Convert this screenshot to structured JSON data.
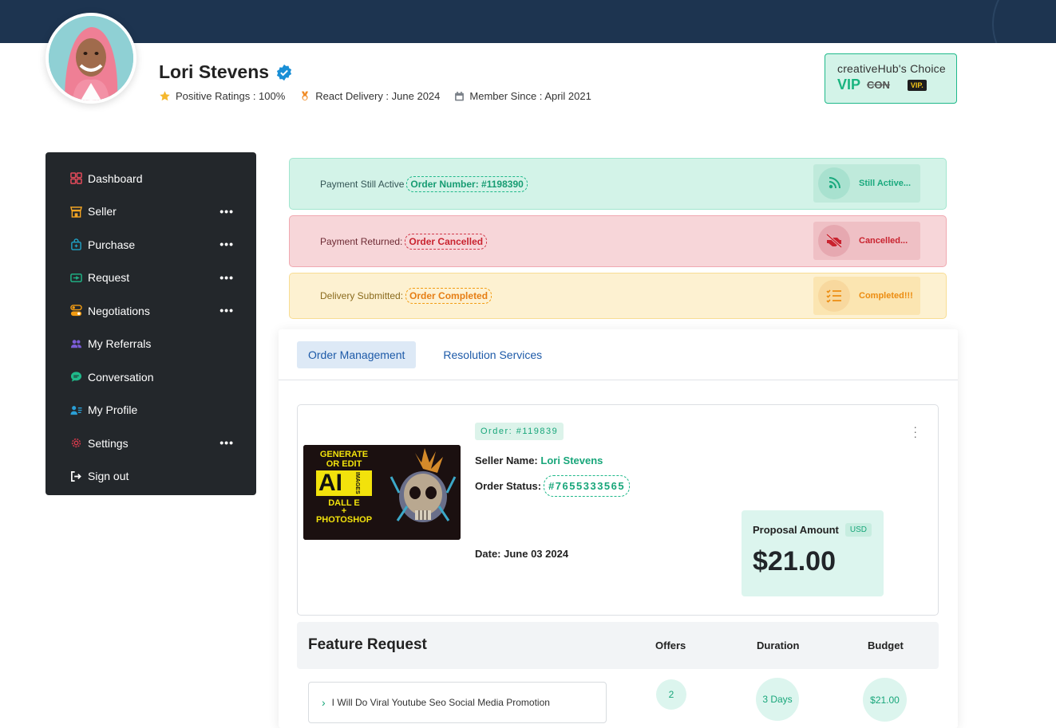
{
  "profile": {
    "name": "Lori Stevens",
    "ratings": "Positive Ratings : 100%",
    "delivery": "React Delivery : June 2024",
    "member_since": "Member Since : April 2021"
  },
  "vip_box": {
    "title": "creativeHub's Choice",
    "vip": "VIP",
    "con": "CON",
    "badge": "VIP."
  },
  "sidebar": {
    "items": [
      {
        "label": "Dashboard",
        "icon": "dashboard-icon",
        "color": "#e24a5a",
        "more": false
      },
      {
        "label": "Seller",
        "icon": "store-icon",
        "color": "#f5a623",
        "more": true
      },
      {
        "label": "Purchase",
        "icon": "bag-icon",
        "color": "#1fa3c8",
        "more": true
      },
      {
        "label": "Request",
        "icon": "ticket-icon",
        "color": "#1fb98a",
        "more": true
      },
      {
        "label": "Negotiations",
        "icon": "toggle-icon",
        "color": "#f39c12",
        "more": true
      },
      {
        "label": "My Referrals",
        "icon": "users-icon",
        "color": "#7b5cd6",
        "more": false
      },
      {
        "label": "Conversation",
        "icon": "chat-icon",
        "color": "#1fb98a",
        "more": false
      },
      {
        "label": "My Profile",
        "icon": "profile-icon",
        "color": "#2a9fd6",
        "more": false
      },
      {
        "label": "Settings",
        "icon": "gear-icon",
        "color": "#d33a4b",
        "more": true
      },
      {
        "label": "Sign out",
        "icon": "signout-icon",
        "color": "#ffffff",
        "more": false
      }
    ],
    "more_glyph": "•••"
  },
  "status": {
    "active": {
      "text": "Payment Still Active",
      "pill": "Order Number: #1198390",
      "button": "Still Active..."
    },
    "cancelled": {
      "text": "Payment Returned:",
      "pill": "Order Cancelled",
      "button": "Cancelled..."
    },
    "completed": {
      "text": "Delivery Submitted:",
      "pill": "Order Completed",
      "button": "Completed!!!"
    }
  },
  "tabs": {
    "order_management": "Order Management",
    "resolution": "Resolution Services"
  },
  "order": {
    "id": "Order: #119839",
    "seller_label": "Seller Name:",
    "seller_name": "Lori Stevens",
    "status_label": "Order Status:",
    "status_value": "#7655333565",
    "date": "Date: June 03 2024",
    "thumb": {
      "line1": "GENERATE",
      "line2": "OR EDIT",
      "ai": "AI",
      "images": "IMAGES",
      "dalle": "DALL E",
      "plus": "+",
      "photoshop": "PHOTOSHOP"
    }
  },
  "proposal": {
    "label": "Proposal Amount",
    "currency": "USD",
    "amount": "$21.00"
  },
  "feature": {
    "title": "Feature Request",
    "col_offers": "Offers",
    "col_duration": "Duration",
    "col_budget": "Budget",
    "row_label": "I Will Do Viral Youtube Seo Social Media Promotion",
    "offers": "2",
    "duration": "3 Days",
    "budget": "$21.00"
  }
}
